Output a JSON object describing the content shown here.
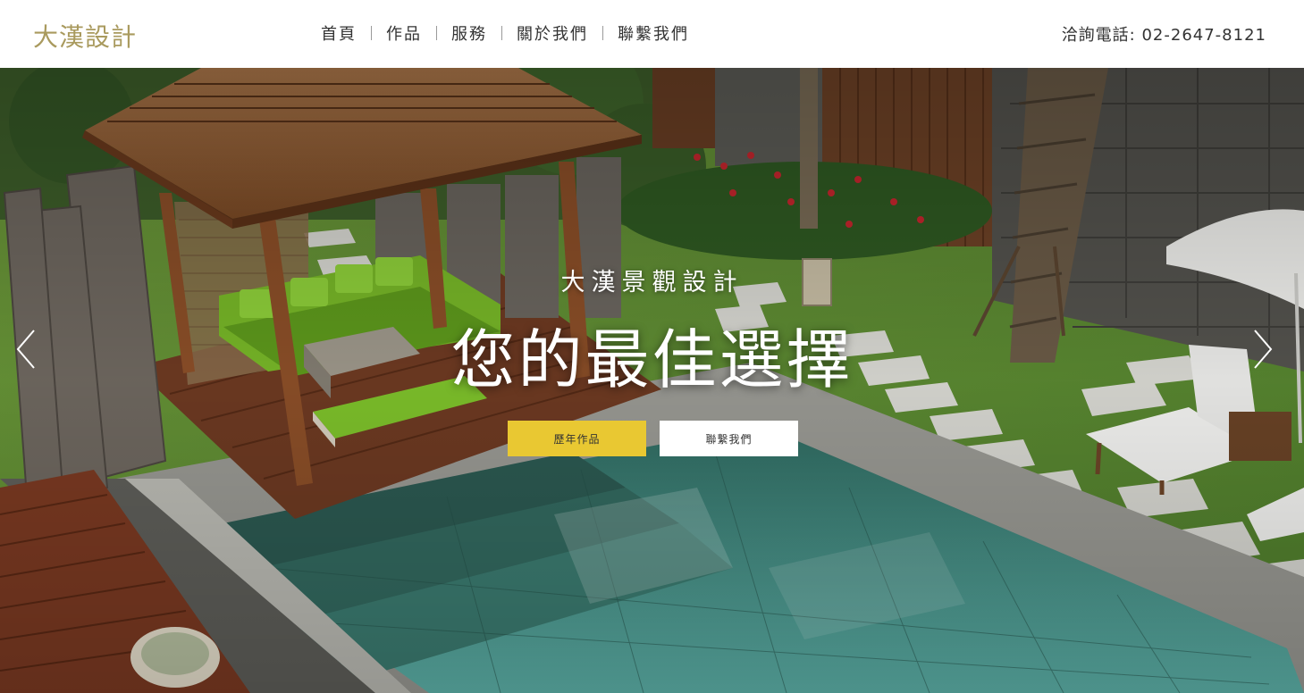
{
  "header": {
    "logo": "大漢設計",
    "nav": [
      {
        "label": "首頁"
      },
      {
        "label": "作品"
      },
      {
        "label": "服務"
      },
      {
        "label": "關於我們"
      },
      {
        "label": "聯繫我們"
      }
    ],
    "phone": "洽詢電話: 02-2647-8121"
  },
  "hero": {
    "subtitle": "大漢景觀設計",
    "title": "您的最佳選擇",
    "buttons": {
      "works": "歷年作品",
      "contact": "聯繫我們"
    },
    "arrows": {
      "prev_icon": "chevron-left-icon",
      "next_icon": "chevron-right-icon"
    }
  },
  "colors": {
    "logo": "#a99a5e",
    "accent_button": "#e9c832",
    "nav_text": "#333333"
  }
}
